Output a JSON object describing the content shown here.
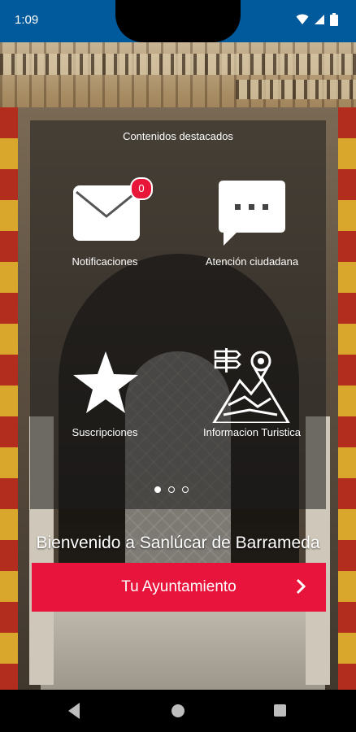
{
  "status": {
    "time": "1:09"
  },
  "overlay": {
    "title": "Contenidos destacados",
    "tiles": [
      {
        "label": "Notificaciones",
        "icon": "envelope-icon",
        "badge": "0"
      },
      {
        "label": "Atención ciudadana",
        "icon": "chat-bubble-icon"
      },
      {
        "label": "Suscripciones",
        "icon": "star-icon"
      },
      {
        "label": "Informacion Turistica",
        "icon": "map-pin-icon"
      }
    ],
    "pager": {
      "count": 3,
      "active": 1
    }
  },
  "welcome_text": "Bienvenido a Sanlúcar de Barrameda",
  "cta": {
    "label": "Tu Ayuntamiento",
    "icon": "chevron-right-icon"
  },
  "colors": {
    "status_bar": "#005a9c",
    "accent": "#e8143b",
    "badge": "#e8173a"
  },
  "nav": {
    "back": "back-icon",
    "home": "home-icon",
    "recent": "recent-apps-icon"
  }
}
